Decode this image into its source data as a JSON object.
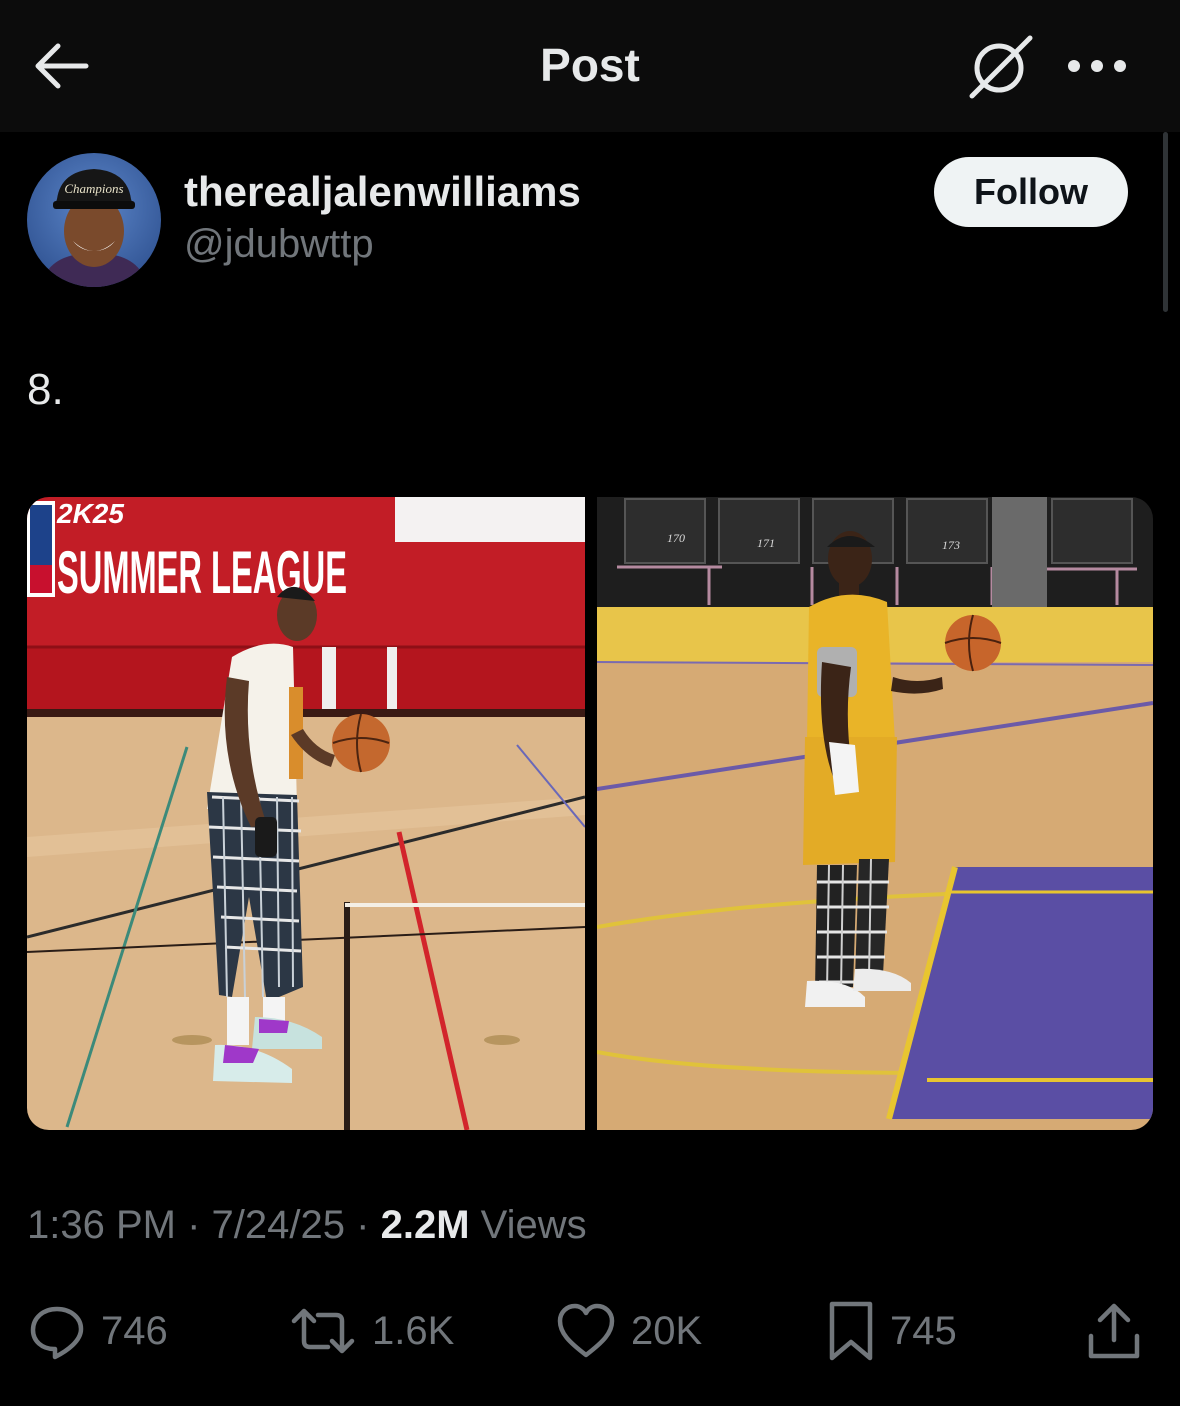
{
  "header": {
    "title": "Post",
    "back_icon": "arrow-left-icon",
    "grok_icon": "grok-icon",
    "more_icon": "more-horizontal-icon"
  },
  "author": {
    "display_name": "therealjalenwilliams",
    "handle": "@jdubwttp",
    "avatar_cap_text": "Champions",
    "follow_label": "Follow"
  },
  "post": {
    "text": "8.",
    "media_left": {
      "banner_line1": "2K25",
      "banner_line2": "SUMMER LEAGUE",
      "seat_numbers": []
    },
    "media_right": {
      "seat_numbers": [
        "170",
        "171",
        "173"
      ]
    },
    "time": "1:36 PM",
    "date": "7/24/25",
    "views_count": "2.2M",
    "views_label": "Views",
    "separator": "·"
  },
  "actions": {
    "reply": {
      "icon": "reply-icon",
      "count": "746"
    },
    "repost": {
      "icon": "repost-icon",
      "count": "1.6K"
    },
    "like": {
      "icon": "heart-icon",
      "count": "20K"
    },
    "bookmark": {
      "icon": "bookmark-icon",
      "count": "745"
    },
    "share": {
      "icon": "share-icon"
    }
  },
  "colors": {
    "background": "#000000",
    "topbar": "#0c0c0c",
    "text_primary": "#e7e9ea",
    "text_secondary": "#71767b",
    "follow_bg": "#eff3f4"
  }
}
